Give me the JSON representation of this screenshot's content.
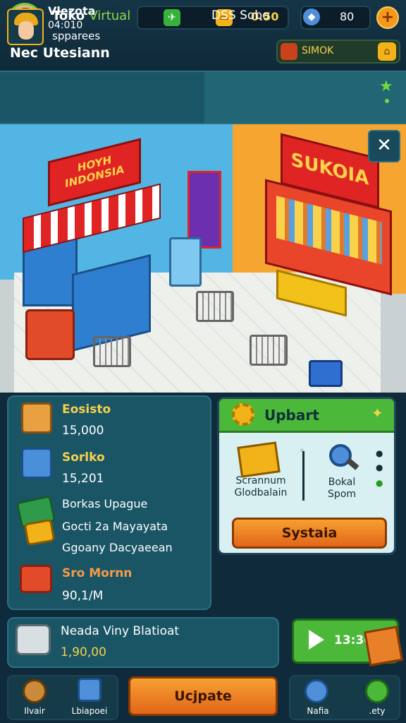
{
  "player": {
    "name": "Vlezota",
    "id": "04:010"
  },
  "page_title": "Nec Utesiann",
  "currency": {
    "coins": "0.50",
    "gems": "80",
    "tag": "SIMOK"
  },
  "store": {
    "title_prefix": "Toko",
    "title_highlight": "Virtual",
    "subtitle": "spparees",
    "right_label": "DSS Sobo"
  },
  "scene": {
    "sign_left": "HOYH INDONSIA",
    "sign_right": "SUKOIA"
  },
  "stats": [
    {
      "label": "Eosisto",
      "value": "15,000"
    },
    {
      "label": "Sorlko",
      "value": "15,201"
    },
    {
      "label": "Borkas Upague"
    },
    {
      "label": "Gocti 2a Mayayata"
    },
    {
      "label": "Ggoany Dacyaeean"
    },
    {
      "label": "Sro Mornn",
      "value": "90,1/M"
    }
  ],
  "upgrade": {
    "title": "Upbart",
    "item1": "Scrannum Glodbalain",
    "item2": "Bokal Spom",
    "button": "Systaia"
  },
  "reward": {
    "title": "Neada Viny Blatioat",
    "value": "1,90,00"
  },
  "play_label": "13:36",
  "bottom_nav": {
    "item1": "Ilvair",
    "item2": "Lbiapoei",
    "main_button": "Ucjpate",
    "item3": "Nafia",
    "item4": ".ety"
  },
  "icons": [
    "leaf-icon",
    "ticket-icon",
    "gem-icon",
    "plus-icon",
    "can-icon",
    "tag-icon",
    "star-icon",
    "close-icon",
    "gear-icon",
    "play-icon"
  ],
  "colors": {
    "accent_orange": "#f39a1c",
    "accent_green": "#4cb83a",
    "panel_teal": "#1a5566",
    "gold_text": "#f7d24a"
  }
}
